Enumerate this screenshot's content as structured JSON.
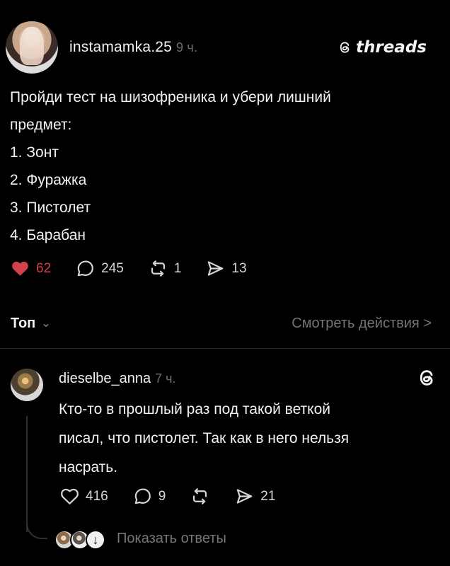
{
  "post": {
    "username": "instamamka.25",
    "time": "9 ч.",
    "brand": "threads",
    "lines": [
      "Пройди тест на шизофреника и убери лишний",
      "предмет:",
      "1. Зонт",
      "2. Фуражка",
      "3. Пистолет",
      "4. Барабан"
    ],
    "actions": {
      "likes": "62",
      "comments": "245",
      "reposts": "1",
      "shares": "13"
    },
    "sort_label": "Топ",
    "view_activity": "Смотреть действия >"
  },
  "comment": {
    "username": "dieselbe_anna",
    "time": "7 ч.",
    "lines": [
      "Кто-то в прошлый раз под такой веткой",
      "писал, что пистолет. Так как в него нельзя",
      "насрать."
    ],
    "actions": {
      "likes": "416",
      "comments": "9",
      "shares": "21"
    },
    "show_replies": "Показать ответы"
  },
  "icons": {
    "heart": "heart-icon",
    "comment": "comment-icon",
    "repost": "repost-icon",
    "share": "send-icon",
    "threads": "threads-icon",
    "chevron": "chevron-down-icon",
    "reply_indicator": "arrow-down-icon"
  },
  "colors": {
    "background": "#000000",
    "text": "#f2f2f2",
    "muted": "#747474",
    "like": "#d3414a",
    "divider": "#262626"
  }
}
